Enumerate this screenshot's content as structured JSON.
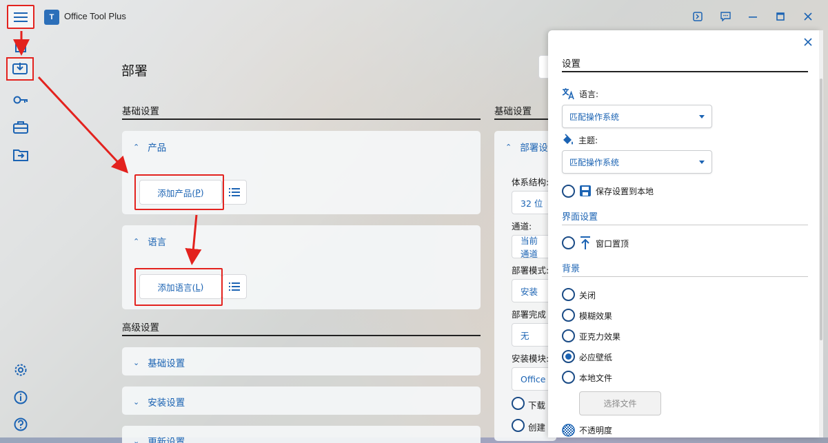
{
  "window": {
    "title": "Office Tool Plus",
    "logo_text": "T"
  },
  "titlebar_icons": [
    "console-icon",
    "feedback-icon",
    "minimize-icon",
    "maximize-icon",
    "close-icon"
  ],
  "sidebar": {
    "items": [
      "home-icon",
      "deploy-icon",
      "activation-key-icon",
      "toolbox-icon",
      "convert-icon",
      "settings-icon",
      "about-icon",
      "help-icon"
    ]
  },
  "main": {
    "page_title": "部署",
    "basic_settings": "基础设置",
    "products_label": "产品",
    "add_product_label": "添加产品(P)",
    "add_product_pre": "添加产品(",
    "add_product_key": "P",
    "add_product_post": ")",
    "languages_label": "语言",
    "add_language_pre": "添加语言(",
    "add_language_key": "L",
    "add_language_post": ")",
    "advanced_settings": "高级设置",
    "adv_basic": "基础设置",
    "adv_install": "安装设置",
    "adv_update": "更新设置"
  },
  "right_column": {
    "title": "基础设置",
    "deploy_settings": "部署设",
    "arch_label": "体系结构:",
    "arch_value": "32 位",
    "channel_label": "通道:",
    "channel_value": "当前通道",
    "mode_label": "部署模式:",
    "mode_value": "安装",
    "finish_label": "部署完成",
    "finish_value": "无",
    "module_label": "安装模块:",
    "module_value": "Office",
    "download_label": "下载",
    "create_label": "创建"
  },
  "settings_panel": {
    "title": "设置",
    "language_label": "语言:",
    "language_value": "匹配操作系统",
    "theme_label": "主题:",
    "theme_value": "匹配操作系统",
    "save_local_label": "保存设置到本地",
    "ui_section": "界面设置",
    "topmost_label": "窗口置顶",
    "background_section": "背景",
    "bg_options": [
      "关闭",
      "模糊效果",
      "亚克力效果",
      "必应壁纸",
      "本地文件"
    ],
    "bg_selected": "必应壁纸",
    "choose_file_label": "选择文件",
    "opacity_label": "不透明度"
  },
  "colors": {
    "accent": "#1b63b3",
    "annotation_red": "#e3221e"
  }
}
